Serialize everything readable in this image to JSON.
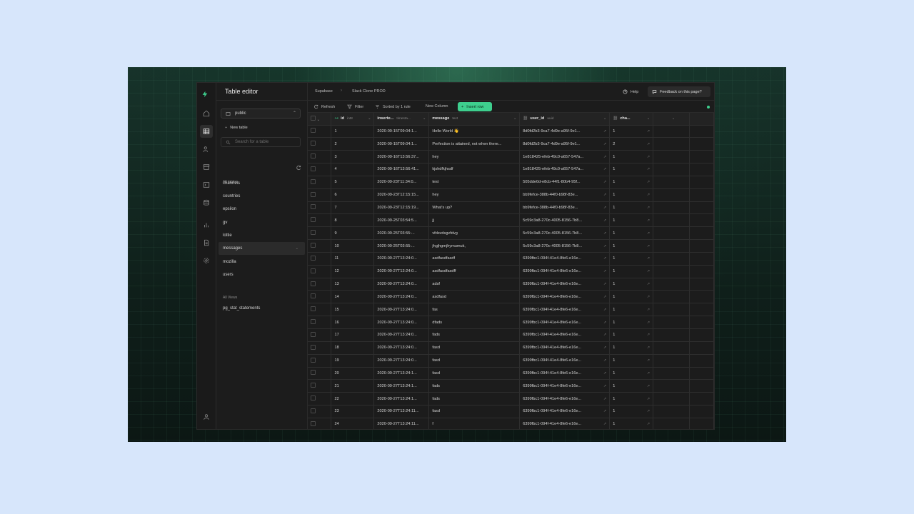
{
  "app": {
    "title": "Table editor",
    "breadcrumb": [
      "Supabase",
      "Slack Clone PROD"
    ],
    "breadcrumb_sep": "›",
    "help_label": "Help",
    "feedback_label": "Feedback on this page?"
  },
  "sidebar": {
    "schema": "public",
    "new_table": "New table",
    "search_placeholder": "Search for a table",
    "all_tables_label": "All tables",
    "tables": [
      "channels",
      "countries",
      "epsilon",
      "gv",
      "lottie",
      "messages",
      "mozilla",
      "users"
    ],
    "active_table": "messages",
    "all_views_label": "All Views",
    "views": [
      "pg_stat_statements"
    ]
  },
  "toolbar": {
    "refresh": "Refresh",
    "filter": "Filter",
    "sorted": "Sorted by 1 rule",
    "new_column": "New Column",
    "insert_row": "Insert row"
  },
  "columns": [
    {
      "name": "id",
      "type": "int8"
    },
    {
      "name": "inserte...",
      "type": "timesta..."
    },
    {
      "name": "message",
      "type": "text"
    },
    {
      "name": "user_id",
      "type": "uuid"
    },
    {
      "name": "cha...",
      "type": ""
    }
  ],
  "rows": [
    [
      "1",
      "2020-09-15T09:04:1...",
      "Hello World 👋",
      "8d0fd2b3-9ca7-4d9e-a95f-9e1...",
      "1"
    ],
    [
      "2",
      "2020-09-15T09:04:1...",
      "Perfection is attained, not when there...",
      "8d0fd2b3-9ca7-4d9e-a95f-9e1...",
      "2"
    ],
    [
      "3",
      "2020-09-16T13:56:37...",
      "hey",
      "1e818425-efeb-49c0-a657-547a...",
      "1"
    ],
    [
      "4",
      "2020-09-16T13:56:41...",
      "kjshdfkjhsdf",
      "1e818425-efeb-49c0-a657-547a...",
      "1"
    ],
    [
      "5",
      "2020-09-23T11:34:0...",
      "test",
      "505dde0d-e8cb-44f1-80b4-95f...",
      "1"
    ],
    [
      "6",
      "2020-09-23T12:15:15...",
      "hey",
      "bb9fefce-388b-44f0-b98f-83e...",
      "1"
    ],
    [
      "7",
      "2020-09-23T12:15:19...",
      "What's up?",
      "bb9fefce-388b-44f0-b98f-83e...",
      "1"
    ],
    [
      "8",
      "2020-09-25T03:54:5...",
      "jj",
      "5c59c3a8-270c-4005-8156-7b8...",
      "1"
    ],
    [
      "9",
      "2020-09-25T03:55:...",
      "vfdsvdsgvfdvg",
      "5c59c3a8-270c-4005-8156-7b8...",
      "1"
    ],
    [
      "10",
      "2020-09-25T03:55:...",
      "jhgjhgmjhymumuk,",
      "5c59c3a8-270c-4005-8156-7b8...",
      "1"
    ],
    [
      "11",
      "2020-09-27T13:24:0...",
      "asdfasdfasdf",
      "6399fbc1-094f-41e4-8fe6-e16e...",
      "1"
    ],
    [
      "12",
      "2020-09-27T13:24:0...",
      "asdfasdfasdff",
      "6399fbc1-094f-41e4-8fe6-e16e...",
      "1"
    ],
    [
      "13",
      "2020-09-27T13:24:0...",
      "adsf",
      "6399fbc1-094f-41e4-8fe6-e16e...",
      "1"
    ],
    [
      "14",
      "2020-09-27T13:24:0...",
      "asdfasd",
      "6399fbc1-094f-41e4-8fe6-e16e...",
      "1"
    ],
    [
      "15",
      "2020-09-27T13:24:0...",
      "fas",
      "6399fbc1-094f-41e4-8fe6-e16e...",
      "1"
    ],
    [
      "16",
      "2020-09-27T13:24:0...",
      "dfads",
      "6399fbc1-094f-41e4-8fe6-e16e...",
      "1"
    ],
    [
      "17",
      "2020-09-27T13:24:0...",
      "fads",
      "6399fbc1-094f-41e4-8fe6-e16e...",
      "1"
    ],
    [
      "18",
      "2020-09-27T13:24:0...",
      "fasd",
      "6399fbc1-094f-41e4-8fe6-e16e...",
      "1"
    ],
    [
      "19",
      "2020-09-27T13:24:0...",
      "fasd",
      "6399fbc1-094f-41e4-8fe6-e16e...",
      "1"
    ],
    [
      "20",
      "2020-09-27T13:24:1...",
      "fasd",
      "6399fbc1-094f-41e4-8fe6-e16e...",
      "1"
    ],
    [
      "21",
      "2020-09-27T13:24:1...",
      "fads",
      "6399fbc1-094f-41e4-8fe6-e16e...",
      "1"
    ],
    [
      "22",
      "2020-09-27T13:24:1...",
      "fads",
      "6399fbc1-094f-41e4-8fe6-e16e...",
      "1"
    ],
    [
      "23",
      "2020-09-27T13:24:11...",
      "fasd",
      "6399fbc1-094f-41e4-8fe6-e16e...",
      "1"
    ],
    [
      "24",
      "2020-09-27T13:24:11...",
      "f",
      "6399fbc1-094f-41e4-8fe6-e16e...",
      "1"
    ]
  ],
  "colors": {
    "accent": "#3ecf8e",
    "page_bg": "#d7e6fb",
    "app_bg": "#1c1c1c"
  },
  "icons": [
    "bolt-logo-icon",
    "home-icon",
    "table-icon",
    "users-icon",
    "storage-icon",
    "terminal-icon",
    "database-icon",
    "reports-icon",
    "docs-icon",
    "settings-icon",
    "user-avatar-icon"
  ]
}
